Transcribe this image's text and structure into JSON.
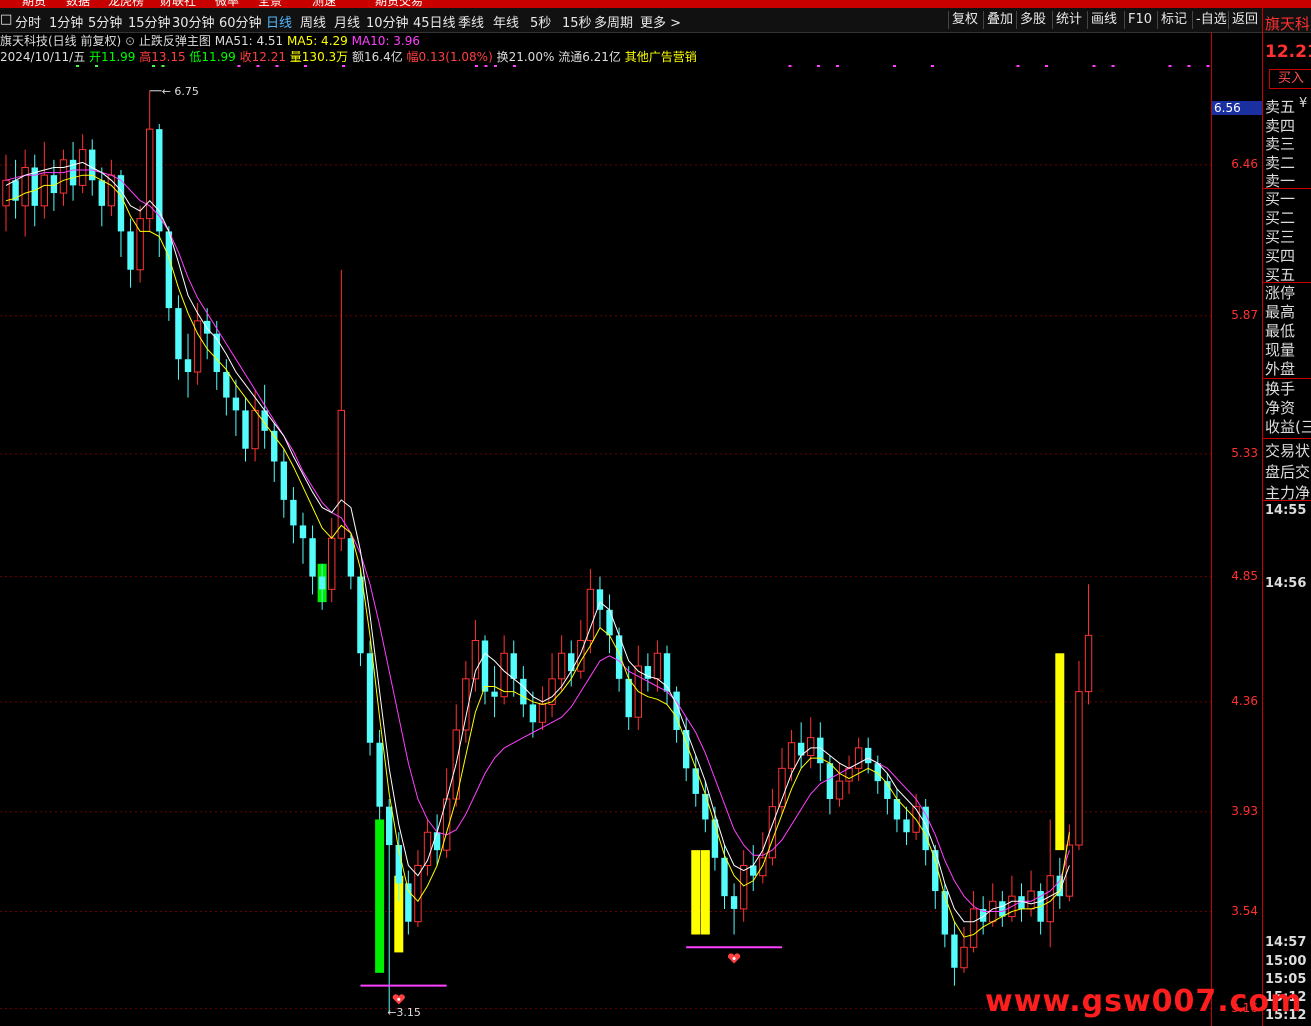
{
  "top_menu": [
    "期货",
    "数据",
    "龙虎榜",
    "财联社",
    "微率",
    "全景",
    "测速",
    "期货交易"
  ],
  "tabs": [
    "分时",
    "1分钟",
    "5分钟",
    "15分钟",
    "30分钟",
    "60分钟",
    "日线",
    "周线",
    "月线",
    "10分钟",
    "45日线",
    "季线",
    "年线",
    "5秒",
    "15秒",
    "多周期",
    "更多 >"
  ],
  "active_tab": "日线",
  "toolbar_right": [
    "复权",
    "叠加",
    "多股",
    "统计",
    "画线",
    "F10",
    "标记",
    "-自选",
    "返回"
  ],
  "info_line1": {
    "stock": "旗天科技(日线 前复权)",
    "indicator": "止跌反弹主图",
    "ma51": "MA51: 4.51",
    "ma5": "MA5: 4.29",
    "ma10": "MA10: 3.96"
  },
  "info_line2": {
    "date": "2024/10/11/五",
    "open": "开11.99",
    "high": "高13.15",
    "low": "低11.99",
    "close": "收12.21",
    "volume": "量130.3万",
    "amount": "额16.4亿",
    "change": "幅0.13(1.08%)",
    "turnover": "换21.00%",
    "float": "流通6.21亿",
    "other": "其他广告营销"
  },
  "y_axis_labels": [
    "6.46",
    "5.87",
    "5.33",
    "4.85",
    "4.36",
    "3.93",
    "3.54",
    "3.16"
  ],
  "current_price_tag": "6.56",
  "high_marker": "6.75",
  "low_marker": "3.15",
  "right_panel": {
    "stock": "旗天科",
    "price": "12.21",
    "buy_button": "买入",
    "sell_levels": [
      "卖五",
      "卖四",
      "卖三",
      "卖二",
      "卖一"
    ],
    "sell_currency": "¥",
    "buy_levels": [
      "买一",
      "买二",
      "买三",
      "买四",
      "买五"
    ],
    "stats1": [
      "涨停",
      "最高",
      "最低",
      "现量",
      "外盘"
    ],
    "stats2": [
      "换手",
      "净资",
      "收益(三"
    ],
    "stats3": [
      "交易状",
      "盘后交",
      "主力净"
    ],
    "times": [
      "14:55",
      "14:56",
      "14:57",
      "15:00",
      "15:05",
      "15:12",
      "15:12"
    ]
  },
  "watermark": "www.gsw007.com",
  "colors": {
    "up": "#ff3232",
    "down": "#54fcfc",
    "ma_white": "#ffffff",
    "ma_yellow": "#ffff00",
    "ma_magenta": "#ff40ff",
    "signal_green": "#00ee00",
    "signal_yellow": "#ffff00"
  },
  "chart_data": {
    "type": "candlestick",
    "y_range": [
      3.1,
      6.8
    ],
    "candles": [
      [
        6.3,
        6.4,
        6.5,
        6.2
      ],
      [
        6.4,
        6.32,
        6.48,
        6.25
      ],
      [
        6.3,
        6.45,
        6.52,
        6.18
      ],
      [
        6.45,
        6.3,
        6.5,
        6.22
      ],
      [
        6.3,
        6.42,
        6.55,
        6.25
      ],
      [
        6.42,
        6.35,
        6.48,
        6.28
      ],
      [
        6.35,
        6.48,
        6.52,
        6.3
      ],
      [
        6.48,
        6.38,
        6.55,
        6.32
      ],
      [
        6.38,
        6.52,
        6.58,
        6.35
      ],
      [
        6.52,
        6.4,
        6.56,
        6.34
      ],
      [
        6.4,
        6.3,
        6.45,
        6.22
      ],
      [
        6.3,
        6.42,
        6.48,
        6.26
      ],
      [
        6.42,
        6.2,
        6.44,
        6.1
      ],
      [
        6.2,
        6.05,
        6.25,
        5.98
      ],
      [
        6.05,
        6.25,
        6.3,
        6.0
      ],
      [
        6.25,
        6.6,
        6.75,
        6.2
      ],
      [
        6.6,
        6.2,
        6.62,
        6.1
      ],
      [
        6.2,
        5.9,
        6.22,
        5.85
      ],
      [
        5.9,
        5.7,
        5.95,
        5.62
      ],
      [
        5.7,
        5.65,
        5.8,
        5.55
      ],
      [
        5.65,
        5.85,
        5.92,
        5.6
      ],
      [
        5.85,
        5.8,
        5.9,
        5.7
      ],
      [
        5.8,
        5.65,
        5.85,
        5.58
      ],
      [
        5.65,
        5.55,
        5.7,
        5.48
      ],
      [
        5.55,
        5.5,
        5.62,
        5.4
      ],
      [
        5.5,
        5.35,
        5.55,
        5.3
      ],
      [
        5.35,
        5.5,
        5.58,
        5.3
      ],
      [
        5.5,
        5.42,
        5.6,
        5.35
      ],
      [
        5.42,
        5.3,
        5.45,
        5.22
      ],
      [
        5.3,
        5.15,
        5.35,
        5.08
      ],
      [
        5.15,
        5.05,
        5.2,
        4.98
      ],
      [
        5.05,
        5.0,
        5.1,
        4.9
      ],
      [
        5.0,
        4.85,
        5.05,
        4.78
      ],
      [
        4.85,
        4.8,
        4.9,
        4.72
      ],
      [
        4.8,
        5.0,
        5.08,
        4.75
      ],
      [
        5.0,
        5.5,
        6.05,
        4.95
      ],
      [
        5.0,
        4.85,
        5.02,
        4.8
      ],
      [
        4.85,
        4.55,
        4.88,
        4.5
      ],
      [
        4.55,
        4.2,
        4.6,
        4.15
      ],
      [
        4.2,
        3.95,
        4.25,
        3.9
      ],
      [
        3.95,
        3.8,
        3.98,
        3.15
      ],
      [
        3.8,
        3.65,
        3.85,
        3.58
      ],
      [
        3.65,
        3.5,
        3.7,
        3.45
      ],
      [
        3.5,
        3.72,
        3.78,
        3.48
      ],
      [
        3.72,
        3.85,
        3.9,
        3.68
      ],
      [
        3.85,
        3.78,
        3.92,
        3.72
      ],
      [
        3.78,
        3.98,
        4.1,
        3.75
      ],
      [
        3.98,
        4.25,
        4.35,
        3.95
      ],
      [
        4.25,
        4.45,
        4.52,
        4.2
      ],
      [
        4.45,
        4.6,
        4.68,
        4.4
      ],
      [
        4.6,
        4.4,
        4.62,
        4.35
      ],
      [
        4.4,
        4.38,
        4.5,
        4.3
      ],
      [
        4.38,
        4.55,
        4.62,
        4.35
      ],
      [
        4.55,
        4.45,
        4.6,
        4.38
      ],
      [
        4.45,
        4.35,
        4.5,
        4.3
      ],
      [
        4.35,
        4.28,
        4.4,
        4.22
      ],
      [
        4.28,
        4.35,
        4.42,
        4.25
      ],
      [
        4.35,
        4.45,
        4.55,
        4.3
      ],
      [
        4.45,
        4.55,
        4.62,
        4.4
      ],
      [
        4.55,
        4.48,
        4.6,
        4.42
      ],
      [
        4.48,
        4.6,
        4.68,
        4.45
      ],
      [
        4.6,
        4.8,
        4.88,
        4.55
      ],
      [
        4.8,
        4.72,
        4.85,
        4.65
      ],
      [
        4.72,
        4.62,
        4.78,
        4.55
      ],
      [
        4.62,
        4.45,
        4.65,
        4.4
      ],
      [
        4.45,
        4.3,
        4.5,
        4.25
      ],
      [
        4.3,
        4.5,
        4.58,
        4.25
      ],
      [
        4.5,
        4.45,
        4.55,
        4.4
      ],
      [
        4.45,
        4.55,
        4.6,
        4.4
      ],
      [
        4.55,
        4.4,
        4.58,
        4.35
      ],
      [
        4.4,
        4.25,
        4.42,
        4.2
      ],
      [
        4.25,
        4.1,
        4.3,
        4.05
      ],
      [
        4.1,
        4.0,
        4.15,
        3.95
      ],
      [
        4.0,
        3.9,
        4.05,
        3.85
      ],
      [
        3.9,
        3.75,
        3.95,
        3.7
      ],
      [
        3.75,
        3.6,
        3.8,
        3.55
      ],
      [
        3.6,
        3.55,
        3.65,
        3.45
      ],
      [
        3.55,
        3.72,
        3.78,
        3.5
      ],
      [
        3.72,
        3.68,
        3.8,
        3.62
      ],
      [
        3.68,
        3.75,
        3.85,
        3.65
      ],
      [
        3.75,
        3.95,
        4.02,
        3.72
      ],
      [
        3.95,
        4.1,
        4.18,
        3.92
      ],
      [
        4.1,
        4.2,
        4.25,
        4.05
      ],
      [
        4.2,
        4.15,
        4.28,
        4.1
      ],
      [
        4.15,
        4.22,
        4.3,
        4.1
      ],
      [
        4.22,
        4.12,
        4.28,
        4.05
      ],
      [
        4.12,
        3.98,
        4.15,
        3.92
      ],
      [
        3.98,
        4.05,
        4.12,
        3.95
      ],
      [
        4.05,
        4.1,
        4.15,
        4.0
      ],
      [
        4.1,
        4.18,
        4.22,
        4.05
      ],
      [
        4.18,
        4.12,
        4.22,
        4.08
      ],
      [
        4.12,
        4.05,
        4.15,
        4.0
      ],
      [
        4.05,
        3.98,
        4.08,
        3.92
      ],
      [
        3.98,
        3.9,
        4.02,
        3.85
      ],
      [
        3.9,
        3.85,
        3.95,
        3.8
      ],
      [
        3.85,
        3.95,
        4.0,
        3.82
      ],
      [
        3.95,
        3.78,
        3.98,
        3.72
      ],
      [
        3.78,
        3.62,
        3.8,
        3.55
      ],
      [
        3.62,
        3.45,
        3.65,
        3.4
      ],
      [
        3.45,
        3.32,
        3.5,
        3.25
      ],
      [
        3.32,
        3.4,
        3.48,
        3.3
      ],
      [
        3.4,
        3.55,
        3.62,
        3.38
      ],
      [
        3.55,
        3.5,
        3.6,
        3.45
      ],
      [
        3.5,
        3.58,
        3.65,
        3.48
      ],
      [
        3.58,
        3.52,
        3.62,
        3.48
      ],
      [
        3.52,
        3.6,
        3.68,
        3.5
      ],
      [
        3.6,
        3.55,
        3.65,
        3.5
      ],
      [
        3.55,
        3.62,
        3.7,
        3.52
      ],
      [
        3.62,
        3.5,
        3.65,
        3.45
      ],
      [
        3.5,
        3.68,
        3.9,
        3.4
      ],
      [
        3.68,
        3.6,
        3.75,
        3.55
      ],
      [
        3.6,
        3.8,
        3.88,
        3.58
      ],
      [
        3.8,
        4.4,
        4.52,
        3.78
      ],
      [
        4.4,
        4.62,
        4.82,
        4.35
      ]
    ],
    "ma_white": [
      6.38,
      6.4,
      6.42,
      6.43,
      6.44,
      6.45,
      6.45,
      6.46,
      6.47,
      6.45,
      6.43,
      6.4,
      6.36,
      6.3,
      6.28,
      6.32,
      6.28,
      6.2,
      6.08,
      5.95,
      5.88,
      5.82,
      5.78,
      5.72,
      5.65,
      5.6,
      5.55,
      5.5,
      5.45,
      5.4,
      5.32,
      5.25,
      5.18,
      5.12,
      5.1,
      5.15,
      5.12,
      4.95,
      4.7,
      4.4,
      4.1,
      3.88,
      3.72,
      3.68,
      3.74,
      3.85,
      3.98,
      4.12,
      4.3,
      4.48,
      4.55,
      4.52,
      4.48,
      4.45,
      4.42,
      4.38,
      4.36,
      4.38,
      4.42,
      4.48,
      4.55,
      4.65,
      4.75,
      4.72,
      4.62,
      4.52,
      4.48,
      4.46,
      4.45,
      4.42,
      4.35,
      4.25,
      4.15,
      4.05,
      3.92,
      3.8,
      3.72,
      3.7,
      3.72,
      3.78,
      3.88,
      3.98,
      4.08,
      4.15,
      4.18,
      4.18,
      4.15,
      4.12,
      4.1,
      4.12,
      4.14,
      4.12,
      4.08,
      4.02,
      3.98,
      3.94,
      3.88,
      3.78,
      3.65,
      3.55,
      3.5,
      3.5,
      3.52,
      3.55,
      3.56,
      3.58,
      3.58,
      3.57,
      3.58,
      3.6,
      3.62,
      3.72
    ],
    "ma_yellow": [
      6.32,
      6.33,
      6.35,
      6.36,
      6.38,
      6.38,
      6.4,
      6.41,
      6.42,
      6.42,
      6.4,
      6.38,
      6.34,
      6.26,
      6.2,
      6.2,
      6.18,
      6.1,
      5.98,
      5.88,
      5.8,
      5.74,
      5.7,
      5.66,
      5.6,
      5.55,
      5.5,
      5.45,
      5.4,
      5.35,
      5.28,
      5.2,
      5.12,
      5.04,
      5.0,
      5.05,
      5.02,
      4.88,
      4.62,
      4.3,
      4.0,
      3.78,
      3.62,
      3.58,
      3.64,
      3.72,
      3.85,
      3.98,
      4.15,
      4.32,
      4.42,
      4.42,
      4.4,
      4.4,
      4.38,
      4.36,
      4.35,
      4.36,
      4.4,
      4.45,
      4.52,
      4.58,
      4.65,
      4.62,
      4.55,
      4.45,
      4.4,
      4.38,
      4.37,
      4.35,
      4.3,
      4.2,
      4.1,
      4.0,
      3.88,
      3.76,
      3.68,
      3.64,
      3.66,
      3.72,
      3.82,
      3.92,
      4.02,
      4.1,
      4.14,
      4.14,
      4.12,
      4.08,
      4.06,
      4.08,
      4.1,
      4.08,
      4.04,
      3.98,
      3.94,
      3.9,
      3.84,
      3.74,
      3.6,
      3.5,
      3.44,
      3.45,
      3.48,
      3.5,
      3.52,
      3.54,
      3.55,
      3.55,
      3.56,
      3.58,
      3.62,
      3.85
    ],
    "ma_magenta": [
      6.4,
      6.41,
      6.42,
      6.42,
      6.43,
      6.43,
      6.43,
      6.44,
      6.44,
      6.44,
      6.43,
      6.42,
      6.4,
      6.36,
      6.32,
      6.3,
      6.26,
      6.2,
      6.12,
      6.02,
      5.94,
      5.88,
      5.82,
      5.76,
      5.7,
      5.64,
      5.58,
      5.52,
      5.46,
      5.4,
      5.34,
      5.26,
      5.2,
      5.14,
      5.1,
      5.08,
      5.02,
      4.94,
      4.82,
      4.66,
      4.48,
      4.3,
      4.12,
      3.98,
      3.9,
      3.85,
      3.84,
      3.86,
      3.92,
      4.0,
      4.08,
      4.14,
      4.18,
      4.2,
      4.22,
      4.24,
      4.26,
      4.28,
      4.3,
      4.34,
      4.4,
      4.46,
      4.52,
      4.54,
      4.52,
      4.48,
      4.46,
      4.44,
      4.42,
      4.4,
      4.36,
      4.3,
      4.24,
      4.16,
      4.06,
      3.96,
      3.86,
      3.8,
      3.76,
      3.76,
      3.78,
      3.82,
      3.88,
      3.94,
      4.0,
      4.04,
      4.06,
      4.08,
      4.1,
      4.12,
      4.14,
      4.12,
      4.1,
      4.06,
      4.02,
      3.98,
      3.92,
      3.84,
      3.74,
      3.66,
      3.6,
      3.56,
      3.54,
      3.54,
      3.54,
      3.56,
      3.58,
      3.58,
      3.6,
      3.62,
      3.66,
      3.78
    ],
    "signal_bars": [
      {
        "index": 39,
        "color": "green",
        "from": 3.3,
        "to": 3.9
      },
      {
        "index": 41,
        "color": "yellow",
        "from": 3.38,
        "to": 3.68
      },
      {
        "index": 33,
        "color": "green",
        "from": 4.75,
        "to": 4.9
      },
      {
        "index": 72,
        "color": "yellow",
        "from": 3.45,
        "to": 3.78
      },
      {
        "index": 73,
        "color": "yellow",
        "from": 3.45,
        "to": 3.78
      },
      {
        "index": 110,
        "color": "yellow",
        "from": 3.78,
        "to": 4.55
      }
    ],
    "support_lines": [
      {
        "from": 37,
        "to": 46,
        "price": 3.25
      },
      {
        "from": 71,
        "to": 81,
        "price": 3.4
      }
    ],
    "markers": [
      {
        "index": 41,
        "price": 3.2
      },
      {
        "index": 76,
        "price": 3.36
      }
    ]
  }
}
